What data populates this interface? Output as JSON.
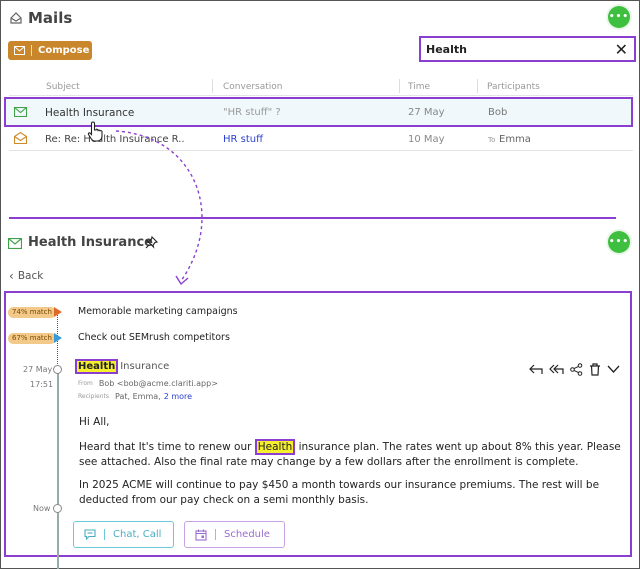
{
  "header": {
    "title": "Mails",
    "compose_label": "Compose"
  },
  "search": {
    "value": "Health"
  },
  "table": {
    "columns": [
      "Subject",
      "Conversation",
      "Time",
      "Participants"
    ],
    "rows": [
      {
        "subject": "Health Insurance",
        "conversation": "\"HR stuff\" ?",
        "time": "27 May",
        "participants": "Bob",
        "to_prefix": ""
      },
      {
        "subject": "Re: Re: Health Insurance R...",
        "conversation": "HR stuff",
        "time": "10 May",
        "participants": "Emma",
        "to_prefix": "To"
      }
    ]
  },
  "detail": {
    "title": "Health Insurance",
    "back_label": "Back",
    "thread": [
      {
        "match": "74% match",
        "subject": "Memorable marketing campaigns"
      },
      {
        "match": "67% match",
        "subject": "Check out SEMrush competitors"
      }
    ],
    "email": {
      "date": "27 May",
      "time": "17:51",
      "subject_highlight": "Health",
      "subject_rest": "Insurance",
      "from_label": "From",
      "from_value": "Bob <bob@acme.clariti.app>",
      "recipients_label": "Recipients",
      "recipients_value": "Pat, Emma,",
      "recipients_more": "2 more",
      "greeting": "Hi All,",
      "p1_before": "Heard that It's time to renew our",
      "p1_highlight": "Health",
      "p1_after": "insurance plan.  The rates went up about 8% this year.  Please see attached. Also the final rate may change by a few dollars after the enrollment is complete.",
      "p2": "In 2025 ACME will continue to pay $450 a month towards our insurance premiums.  The rest will be deducted from our pay check on a semi monthly basis."
    },
    "now_label": "Now",
    "chat_call_label": "Chat, Call",
    "schedule_label": "Schedule"
  },
  "colors": {
    "accent": "#8a3fd1",
    "compose": "#c9862b",
    "green": "#3fbf3f",
    "link": "#2a3fd1"
  }
}
